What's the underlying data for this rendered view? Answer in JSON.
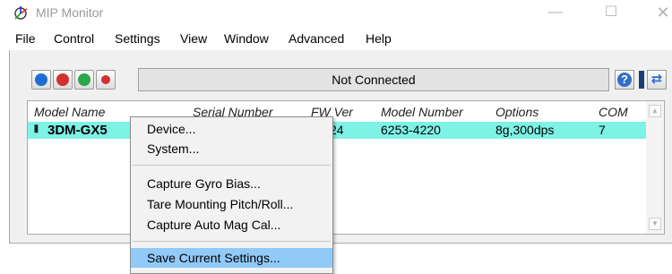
{
  "window": {
    "title": "MIP Monitor",
    "min_glyph": "—",
    "max_glyph": "☐",
    "close_glyph": "✕"
  },
  "menubar": [
    "File",
    "Control",
    "Settings",
    "View",
    "Window",
    "Advanced",
    "Help"
  ],
  "toolbar": {
    "status": "Not Connected",
    "buttons": [
      {
        "icon": "play-icon",
        "color": "#1e6ed2"
      },
      {
        "icon": "stop-icon",
        "color": "#d23030"
      },
      {
        "icon": "record-green-icon",
        "color": "#2aa84a"
      },
      {
        "icon": "record-red-icon",
        "color": "#d23030"
      }
    ],
    "help_glyph": "?",
    "refresh_glyph": "⇄"
  },
  "table": {
    "columns": [
      "Model Name",
      "Serial Number",
      "FW Ver",
      "Model Number",
      "Options",
      "COM"
    ],
    "row": {
      "icon_glyph": "⦀",
      "model_name": "3DM-GX5",
      "fw_ver": "24",
      "model_number": "6253-4220",
      "options": "8g,300dps",
      "com": "7"
    },
    "selected_color": "#7ff2e6"
  },
  "context_menu": {
    "items": [
      "Device...",
      "System...",
      "Capture Gyro Bias...",
      "Tare Mounting Pitch/Roll...",
      "Capture Auto Mag Cal...",
      "Save Current Settings..."
    ],
    "highlighted": "Save Current Settings...",
    "highlight_color": "#91c9f7"
  }
}
